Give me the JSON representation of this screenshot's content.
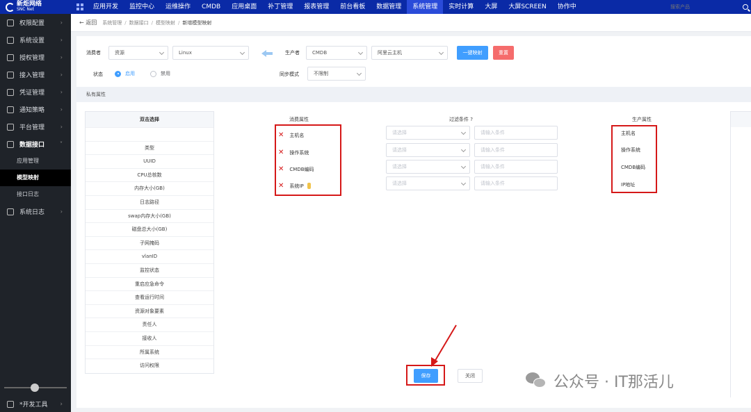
{
  "logo": {
    "name": "新炬网络",
    "sub": "SNC Net"
  },
  "topnav": [
    "应用开发",
    "监控中心",
    "运维操作",
    "CMDB",
    "应用桌面",
    "补丁管理",
    "报表管理",
    "前台看板",
    "数据管理",
    "系统管理",
    "实时计算",
    "大屏",
    "大屏SCREEN",
    "协作中"
  ],
  "topnav_active_index": 9,
  "search": {
    "placeholder": "搜索产品"
  },
  "sidebar": {
    "items": [
      {
        "label": "权限配置",
        "icon": "user-icon"
      },
      {
        "label": "系统设置",
        "icon": "gear-icon"
      },
      {
        "label": "授权管理",
        "icon": "gear-icon"
      },
      {
        "label": "接入管理",
        "icon": "plug-icon"
      },
      {
        "label": "凭证管理",
        "icon": "document-icon"
      },
      {
        "label": "通知策略",
        "icon": "message-icon"
      },
      {
        "label": "平台管理",
        "icon": "platform-icon"
      },
      {
        "label": "数据接口",
        "icon": "interface-icon"
      }
    ],
    "subitems": [
      "应用管理",
      "模型映射",
      "接口日志"
    ],
    "after": {
      "label": "系统日志",
      "icon": "log-icon"
    },
    "bottom": {
      "label": "*开发工具",
      "icon": "wrench-icon"
    }
  },
  "breadcrumb": {
    "back": "返回",
    "items": [
      "系统管理",
      "数据接口",
      "模型映射",
      "新增模型映射"
    ]
  },
  "form": {
    "consumer_label": "消费者",
    "consumer_value": "资源",
    "consumer_sub_value": "Linux",
    "producer_label": "生产者",
    "producer_value": "CMDB",
    "producer_sub_value": "阿里云主机",
    "one_click_button": "一键映射",
    "reset_button": "重置",
    "status_label": "状态",
    "status_enable": "启用",
    "status_disable": "禁用",
    "sync_label": "同步模式",
    "sync_value": "不限制"
  },
  "section_title": "私有属性",
  "double_click_panel": {
    "title": "双击选择",
    "items": [
      "",
      "类型",
      "UUID",
      "CPU总核数",
      "内存大小(GB)",
      "日志路径",
      "swap内存大小(GB)",
      "磁盘总大小(GB)",
      "子网掩码",
      "vlanID",
      "监控状态",
      "重启应急命令",
      "查看运行时间",
      "资源对象要素",
      "责任人",
      "接收人",
      "所属系统",
      "访问权限"
    ]
  },
  "mapping": {
    "consumer_head": "消费属性",
    "filter_head": "过滤条件 ?",
    "producer_head": "生产属性",
    "consumer_attrs": [
      "主机名",
      "操作系统",
      "CMDB编码",
      "系统IP"
    ],
    "filter_select_placeholder": "请选择",
    "filter_input_placeholder": "请输入条件",
    "producer_attrs": [
      "主机名",
      "操作系统",
      "CMDB编码",
      "IP地址"
    ]
  },
  "actions": {
    "save": "保存",
    "close": "关闭"
  },
  "watermark": "公众号 · IT那活儿",
  "colors": {
    "topbar": "#0a2aa6",
    "sidebar": "#1f2329",
    "primary": "#409eff",
    "danger": "#f56c6c",
    "highlight": "#d51818"
  }
}
